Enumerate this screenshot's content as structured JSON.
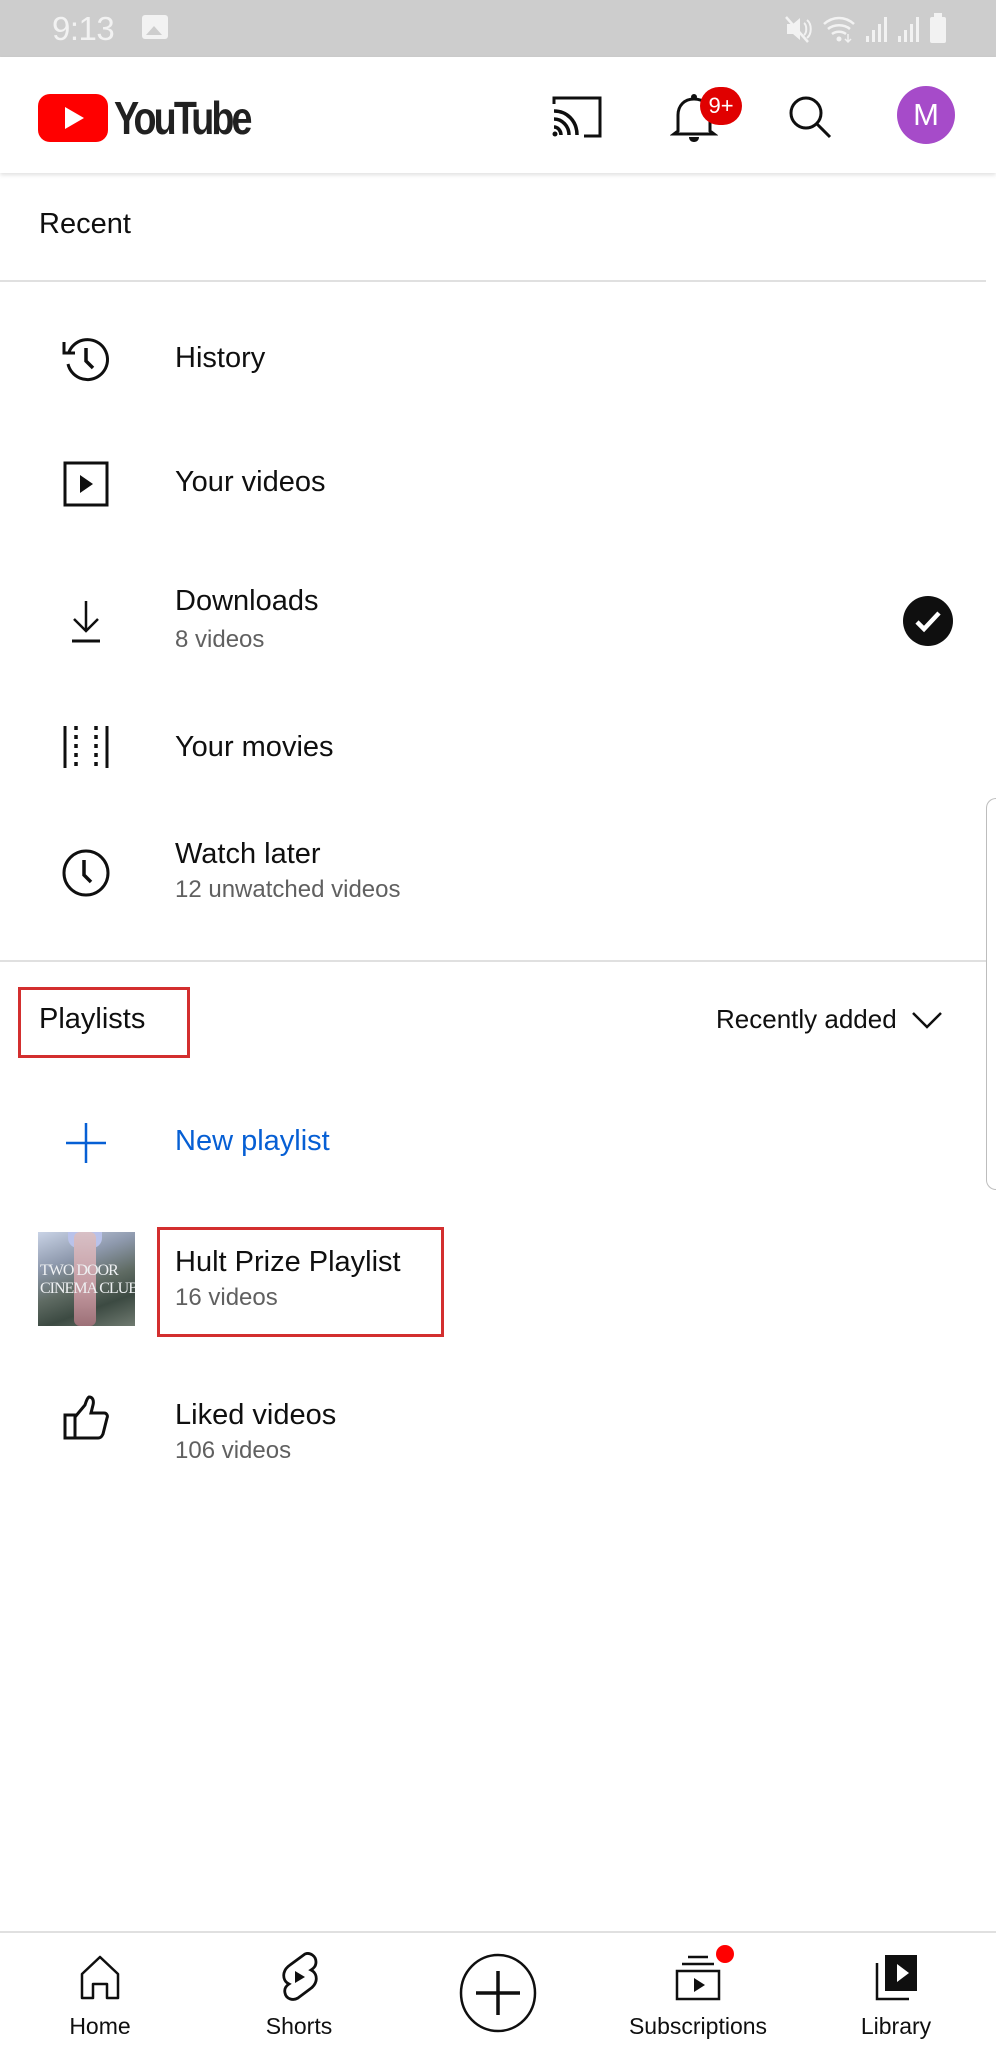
{
  "status_bar": {
    "time": "9:13",
    "icons": [
      "gallery-icon",
      "mute-icon",
      "wifi-icon",
      "signal-icon",
      "signal-icon",
      "battery-icon"
    ]
  },
  "header": {
    "logo_text": "YouTube",
    "notification_badge": "9+",
    "avatar_initial": "M",
    "colors": {
      "brand_red": "#ff0000",
      "avatar": "#a64bc9",
      "badge": "#e00000"
    }
  },
  "recent": {
    "label": "Recent"
  },
  "library_items": [
    {
      "icon": "history-icon",
      "title": "History",
      "subtitle": ""
    },
    {
      "icon": "your-videos-icon",
      "title": "Your videos",
      "subtitle": ""
    },
    {
      "icon": "download-icon",
      "title": "Downloads",
      "subtitle": "8 videos",
      "status": "downloaded-check"
    },
    {
      "icon": "movies-icon",
      "title": "Your movies",
      "subtitle": ""
    },
    {
      "icon": "watch-later-icon",
      "title": "Watch later",
      "subtitle": "12 unwatched videos"
    }
  ],
  "playlists": {
    "label": "Playlists",
    "sort_label": "Recently added",
    "new_playlist_label": "New playlist",
    "link_color": "#065fd4",
    "items": [
      {
        "title": "Hult Prize Playlist",
        "subtitle": "16 videos",
        "thumbnail_text_1": "TWO DOOR",
        "thumbnail_text_2": "CINEMA CLUB"
      },
      {
        "title": "Liked videos",
        "subtitle": "106 videos",
        "icon": "thumbs-up-icon"
      }
    ]
  },
  "annotations": {
    "highlight_color": "#d32f2f"
  },
  "bottom_nav": {
    "items": [
      {
        "label": "Home",
        "icon": "home-icon"
      },
      {
        "label": "Shorts",
        "icon": "shorts-icon"
      },
      {
        "label": "",
        "icon": "create-icon"
      },
      {
        "label": "Subscriptions",
        "icon": "subscriptions-icon",
        "has_dot": true
      },
      {
        "label": "Library",
        "icon": "library-icon",
        "active": true
      }
    ]
  }
}
